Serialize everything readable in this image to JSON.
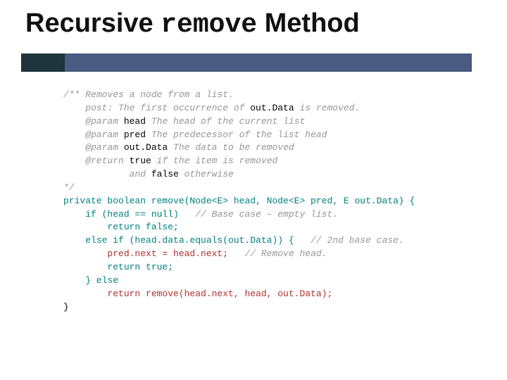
{
  "title": {
    "part1": "Recursive ",
    "mono": "remove",
    "part2": " Method"
  },
  "code": {
    "l01a": "/** ",
    "l01b": "Removes a node from a list.",
    "l02a": "    post: The first occurrence of ",
    "l02b": "out.Data ",
    "l02c": "is removed.",
    "l03a": "    @param ",
    "l03b": "head ",
    "l03c": "The head of the current list",
    "l04a": "    @param ",
    "l04b": "pred ",
    "l04c": "The predecessor of the list head",
    "l05a": "    @param ",
    "l05b": "out.Data ",
    "l05c": "The data to be removed",
    "l06a": "    @return ",
    "l06b": "true ",
    "l06c": "if the item is removed",
    "l07a": "            and ",
    "l07b": "false ",
    "l07c": "otherwise",
    "l08": "*/",
    "l09": "private boolean remove(Node<E> head, Node<E> pred, E out.Data) {",
    "l10a": "    if (head == null)   ",
    "l10b": "// Base case – empty list.",
    "l11": "        return false;",
    "l12a": "    else if (head.data.equals(out.Data)) {   ",
    "l12b": "// 2nd base case.",
    "l13a": "        pred.next = head.next;   ",
    "l13b": "// Remove head.",
    "l14": "        return true;",
    "l15": "    } else",
    "l16": "        return remove(head.next, head, out.Data);",
    "l17": "}"
  }
}
